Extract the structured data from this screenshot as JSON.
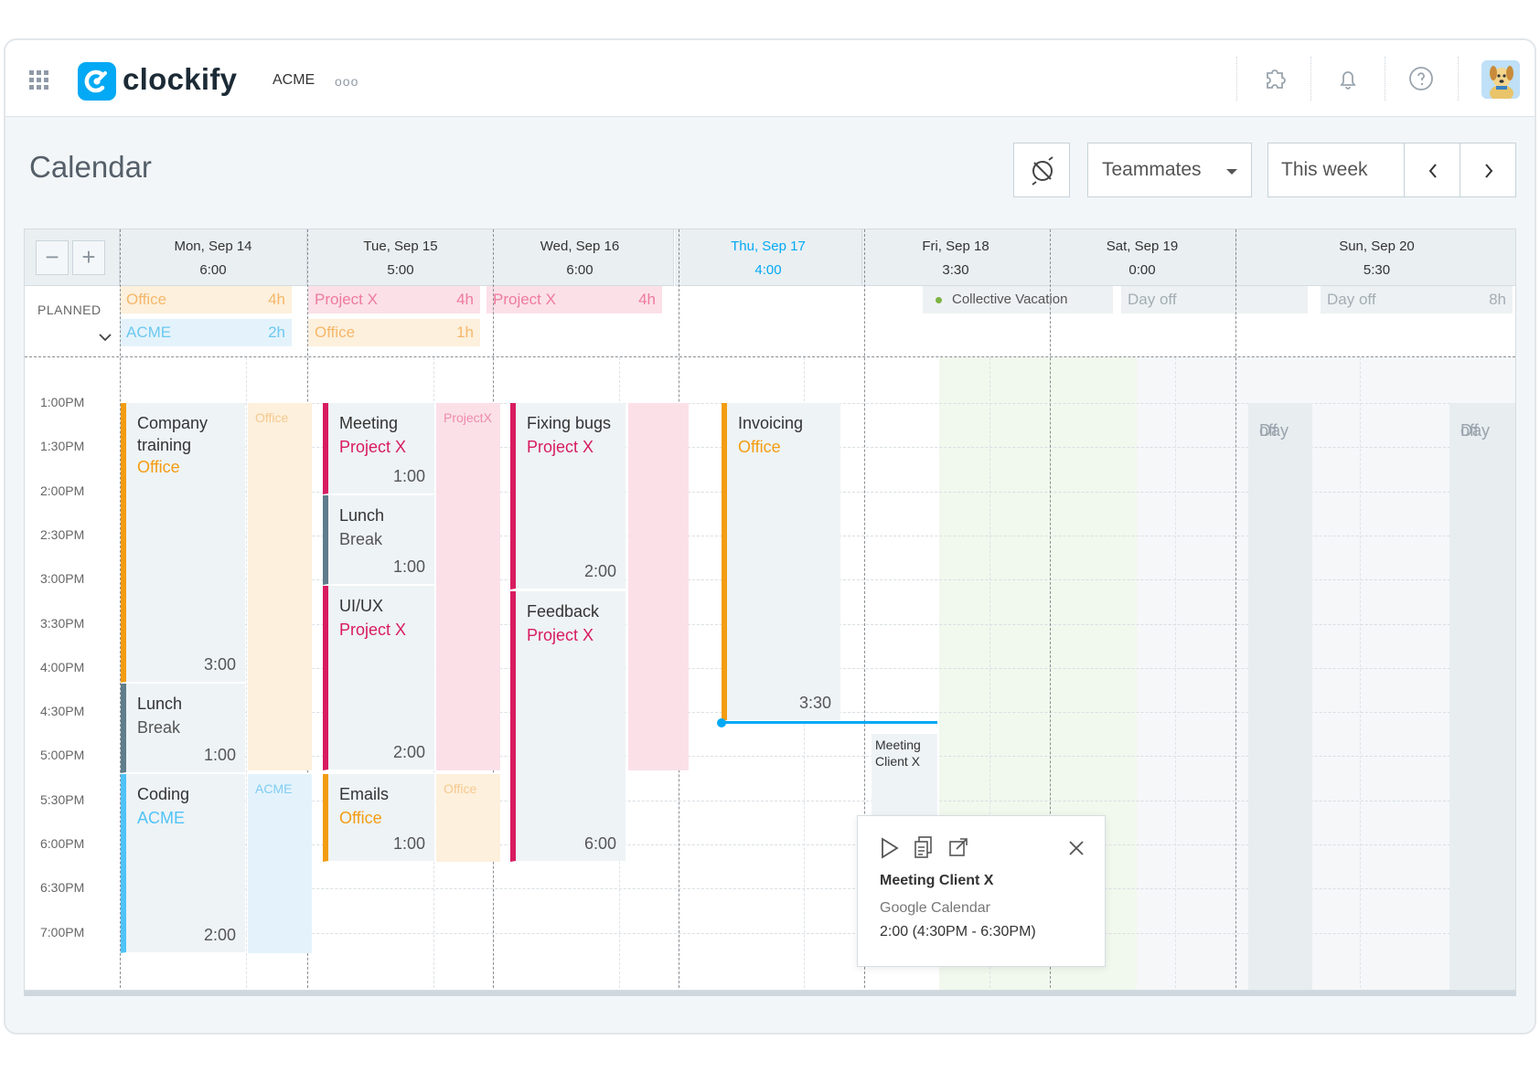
{
  "topbar": {
    "logo_text": "clockify",
    "workspace": "ACME",
    "more": "ooo"
  },
  "header": {
    "title": "Calendar",
    "teammates_label": "Teammates",
    "range_label": "This week"
  },
  "zoom": {
    "minus": "−",
    "plus": "+"
  },
  "days": [
    {
      "date": "Mon, Sep 14",
      "total": "6:00",
      "today": false
    },
    {
      "date": "Tue, Sep 15",
      "total": "5:00",
      "today": false
    },
    {
      "date": "Wed, Sep 16",
      "total": "6:00",
      "today": false
    },
    {
      "date": "Thu, Sep 17",
      "total": "4:00",
      "today": true
    },
    {
      "date": "Fri, Sep 18",
      "total": "3:30",
      "today": false
    },
    {
      "date": "Sat, Sep 19",
      "total": "0:00",
      "today": false
    },
    {
      "date": "Sun, Sep 20",
      "total": "5:30",
      "today": false
    }
  ],
  "planned": {
    "label": "PLANNED",
    "mon": [
      {
        "name": "Office",
        "hours": "4h"
      },
      {
        "name": "ACME",
        "hours": "2h"
      }
    ],
    "tue": [
      {
        "name": "Project X",
        "hours": "4h"
      },
      {
        "name": "Office",
        "hours": "1h"
      }
    ],
    "wed": [
      {
        "name": "Project X",
        "hours": "4h"
      }
    ],
    "fri": [
      {
        "name": "Collective Vacation"
      }
    ],
    "sat": [
      {
        "name": "Day off"
      }
    ],
    "sun": [
      {
        "name": "Day off",
        "hours": "8h"
      }
    ]
  },
  "times": [
    "1:00PM",
    "1:30PM",
    "2:00PM",
    "2:30PM",
    "3:00PM",
    "3:30PM",
    "4:00PM",
    "4:30PM",
    "5:00PM",
    "5:30PM",
    "6:00PM",
    "6:30PM",
    "7:00PM"
  ],
  "entries": {
    "mon_training": {
      "title": "Company training",
      "title_l1": "Company",
      "title_l2": "training",
      "project": "Office",
      "duration": "3:00"
    },
    "mon_lunch": {
      "title": "Lunch",
      "project": "Break",
      "duration": "1:00"
    },
    "mon_coding": {
      "title": "Coding",
      "project": "ACME",
      "duration": "2:00"
    },
    "tue_meeting": {
      "title": "Meeting",
      "project": "Project X",
      "duration": "1:00"
    },
    "tue_lunch": {
      "title": "Lunch",
      "project": "Break",
      "duration": "1:00"
    },
    "tue_uiux": {
      "title": "UI/UX",
      "project": "Project X",
      "duration": "2:00"
    },
    "tue_emails": {
      "title": "Emails",
      "project": "Office",
      "duration": "1:00"
    },
    "wed_bugs": {
      "title": "Fixing bugs",
      "project": "Project X",
      "duration": "2:00"
    },
    "wed_feedback": {
      "title": "Feedback",
      "project": "Project X",
      "duration": "6:00"
    },
    "thu_invoicing": {
      "title": "Invoicing",
      "project": "Office",
      "duration": "3:30"
    }
  },
  "planned_blocks": {
    "mon_office": "Office",
    "mon_acme": "ACME",
    "tue_projectx": "ProjectX",
    "tue_office": "Office",
    "sat_dayoff_l1": "Day",
    "sat_dayoff_l2": "off",
    "sun_dayoff_l1": "Day",
    "sun_dayoff_l2": "off"
  },
  "calendar_event": {
    "title_l1": "Meeting",
    "title_l2": "Client X"
  },
  "popup": {
    "title": "Meeting Client X",
    "source": "Google Calendar",
    "time": "2:00 (4:30PM - 6:30PM)"
  },
  "colors": {
    "brand": "#03a9f4",
    "office": "#f39c12",
    "project_x": "#d81b60",
    "acme": "#4fc3f7",
    "break": "#607d8b"
  },
  "icons": [
    "grid-icon",
    "puzzle-icon",
    "bell-icon",
    "help-icon",
    "avatar",
    "no-sync-icon",
    "caret-down-icon",
    "chevron-left-icon",
    "chevron-right-icon",
    "play-icon",
    "copy-icon",
    "open-icon",
    "close-icon"
  ]
}
